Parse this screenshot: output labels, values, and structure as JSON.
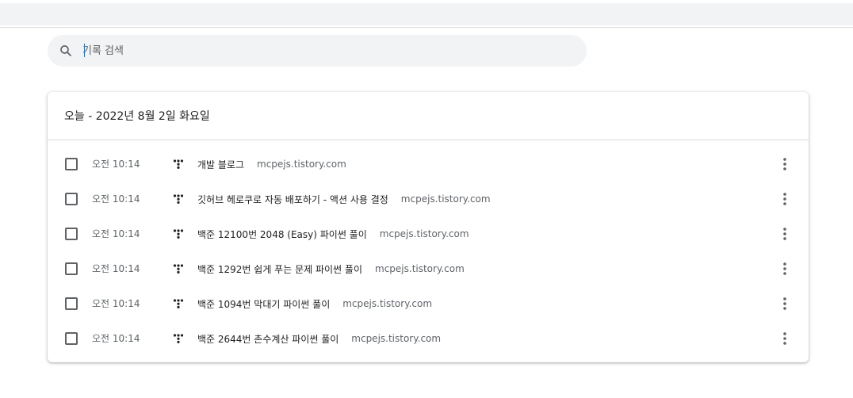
{
  "search": {
    "placeholder": "기록 검색",
    "value": ""
  },
  "day_header": "오늘 - 2022년 8월 2일 화요일",
  "entries": [
    {
      "time": "오전 10:14",
      "title": "개발 블로그",
      "domain": "mcpejs.tistory.com",
      "favicon": "tistory-icon"
    },
    {
      "time": "오전 10:14",
      "title": "깃허브 헤로쿠로 자동 배포하기 - 액션 사용 결정",
      "domain": "mcpejs.tistory.com",
      "favicon": "tistory-icon"
    },
    {
      "time": "오전 10:14",
      "title": "백준 12100번 2048 (Easy) 파이썬 풀이",
      "domain": "mcpejs.tistory.com",
      "favicon": "tistory-icon"
    },
    {
      "time": "오전 10:14",
      "title": "백준 1292번 쉽게 푸는 문제 파이썬 풀이",
      "domain": "mcpejs.tistory.com",
      "favicon": "tistory-icon"
    },
    {
      "time": "오전 10:14",
      "title": "백준 1094번 막대기 파이썬 풀이",
      "domain": "mcpejs.tistory.com",
      "favicon": "tistory-icon"
    },
    {
      "time": "오전 10:14",
      "title": "백준 2644번 촌수계산 파이썬 풀이",
      "domain": "mcpejs.tistory.com",
      "favicon": "tistory-icon"
    }
  ],
  "colors": {
    "accent": "#1a73e8",
    "search_bg": "#f1f3f4",
    "secondary_text": "#5f6368",
    "divider": "#dadce0"
  }
}
